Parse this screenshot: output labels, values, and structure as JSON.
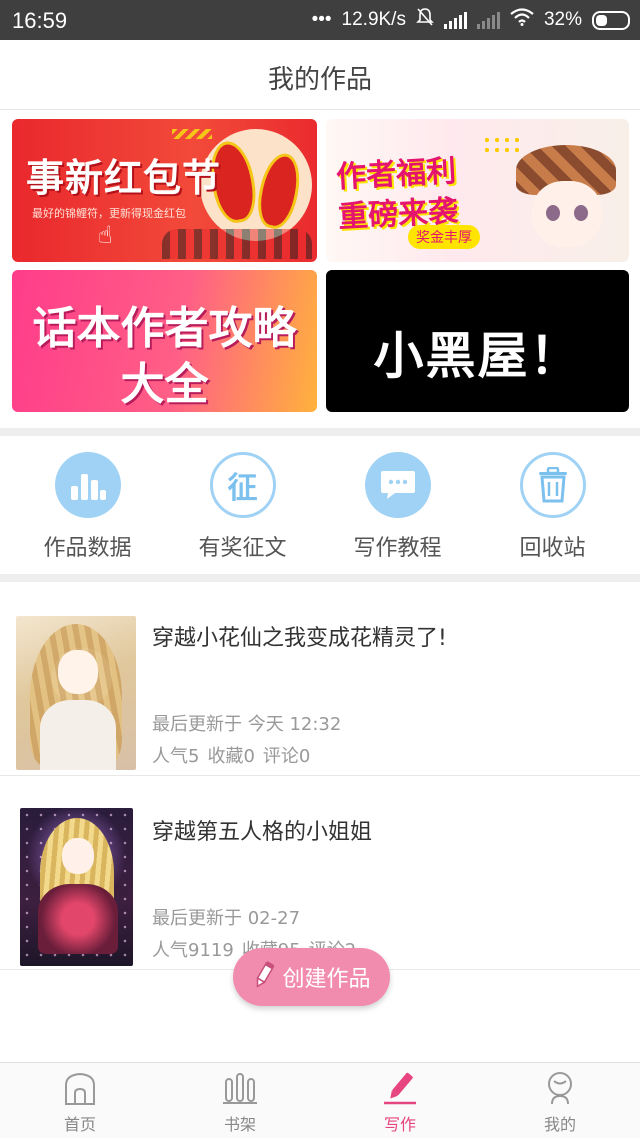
{
  "status_bar": {
    "time": "16:59",
    "speed": "12.9K/s",
    "battery": "32%",
    "dots": "•••"
  },
  "header": {
    "title": "我的作品"
  },
  "banners": [
    {
      "title": "事新红包节",
      "subtitle": "最好的锦鲤符，更新得现金红包",
      "color": "#e9282d"
    },
    {
      "title_line1": "作者福利",
      "title_line2": "重磅来袭",
      "tag": "奖金丰厚"
    },
    {
      "title_line1": "话本作者攻略",
      "title_line2": "大全"
    },
    {
      "title": "小黑屋！"
    }
  ],
  "quick_entries": [
    {
      "label": "作品数据",
      "icon": "bar-chart-icon"
    },
    {
      "label": "有奖征文",
      "icon": "zheng-badge-icon",
      "glyph": "征"
    },
    {
      "label": "写作教程",
      "icon": "chat-bubble-icon"
    },
    {
      "label": "回收站",
      "icon": "trash-icon"
    }
  ],
  "works": [
    {
      "title": "穿越小花仙之我变成花精灵了!",
      "updated": "最后更新于 今天 12:32",
      "popularity": "人气5",
      "favorites": "收藏0",
      "comments": "评论0"
    },
    {
      "title": "穿越第五人格的小姐姐",
      "updated": "最后更新于 02-27",
      "popularity": "人气9119",
      "favorites": "收藏95",
      "comments": "评论2"
    }
  ],
  "fab": {
    "label": "创建作品",
    "color": "#f28cae"
  },
  "bottom_nav": [
    {
      "label": "首页",
      "icon": "home-icon",
      "active": false
    },
    {
      "label": "书架",
      "icon": "bookshelf-icon",
      "active": false
    },
    {
      "label": "写作",
      "icon": "pencil-icon",
      "active": true
    },
    {
      "label": "我的",
      "icon": "profile-icon",
      "active": false
    }
  ],
  "colors": {
    "accent": "#e6457f",
    "icon_blue": "#9fd2f4",
    "status_bar": "#3f3f3f"
  }
}
